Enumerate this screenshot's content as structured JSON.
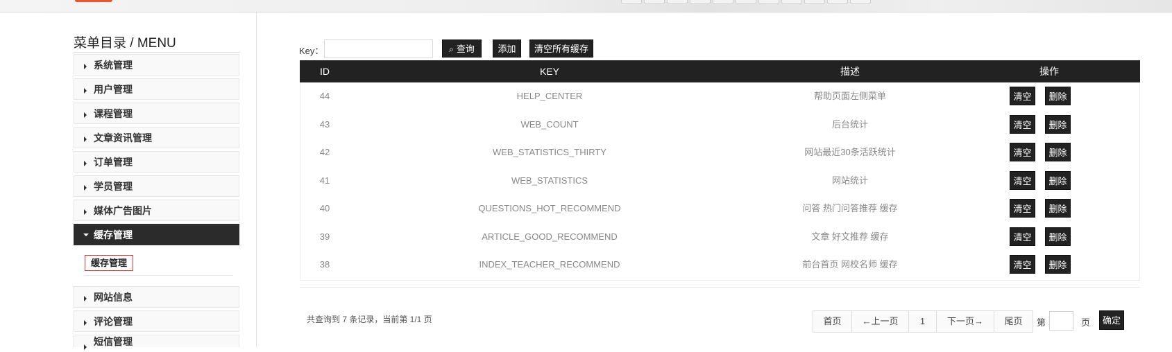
{
  "sidebar": {
    "title": "菜单目录 / MENU",
    "items": [
      {
        "label": "系统管理"
      },
      {
        "label": "用户管理"
      },
      {
        "label": "课程管理"
      },
      {
        "label": "文章资讯管理"
      },
      {
        "label": "订单管理"
      },
      {
        "label": "学员管理"
      },
      {
        "label": "媒体广告图片"
      },
      {
        "label": "缓存管理",
        "active": true
      },
      {
        "label": "网站信息"
      },
      {
        "label": "评论管理"
      },
      {
        "label": "短信管理"
      }
    ],
    "submenu": {
      "label": "缓存管理"
    }
  },
  "search": {
    "key_label": "Key：",
    "input_value": "",
    "query_button": "查询",
    "add_button": "添加",
    "clear_all_button": "清空所有缓存"
  },
  "table": {
    "headers": [
      "ID",
      "KEY",
      "描述",
      "操作"
    ],
    "rows": [
      {
        "id": "44",
        "key": "HELP_CENTER",
        "desc": "帮助页面左侧菜单",
        "clear": "清空",
        "delete": "删除"
      },
      {
        "id": "43",
        "key": "WEB_COUNT",
        "desc": "后台统计",
        "clear": "清空",
        "delete": "删除"
      },
      {
        "id": "42",
        "key": "WEB_STATISTICS_THIRTY",
        "desc": "网站最近30条活跃统计",
        "clear": "清空",
        "delete": "删除"
      },
      {
        "id": "41",
        "key": "WEB_STATISTICS",
        "desc": "网站统计",
        "clear": "清空",
        "delete": "删除"
      },
      {
        "id": "40",
        "key": "QUESTIONS_HOT_RECOMMEND",
        "desc": "问答 热门问答推荐 缓存",
        "clear": "清空",
        "delete": "删除"
      },
      {
        "id": "39",
        "key": "ARTICLE_GOOD_RECOMMEND",
        "desc": "文章 好文推荐 缓存",
        "clear": "清空",
        "delete": "删除"
      },
      {
        "id": "38",
        "key": "INDEX_TEACHER_RECOMMEND",
        "desc": "前台首页 网校名师 缓存",
        "clear": "清空",
        "delete": "删除"
      }
    ]
  },
  "pagination": {
    "summary": "共查询到 7 条记录，当前第 1/1 页",
    "first": "首页",
    "prev": "←上一页",
    "current": "1",
    "next": "下一页→",
    "last": "尾页",
    "goto_prefix": "第",
    "goto_input": "",
    "goto_suffix": "页",
    "confirm": "确定"
  },
  "colors": {
    "dark": "#222222",
    "highlight_border": "#e03a3a",
    "brand_chip": "#e8562a"
  }
}
